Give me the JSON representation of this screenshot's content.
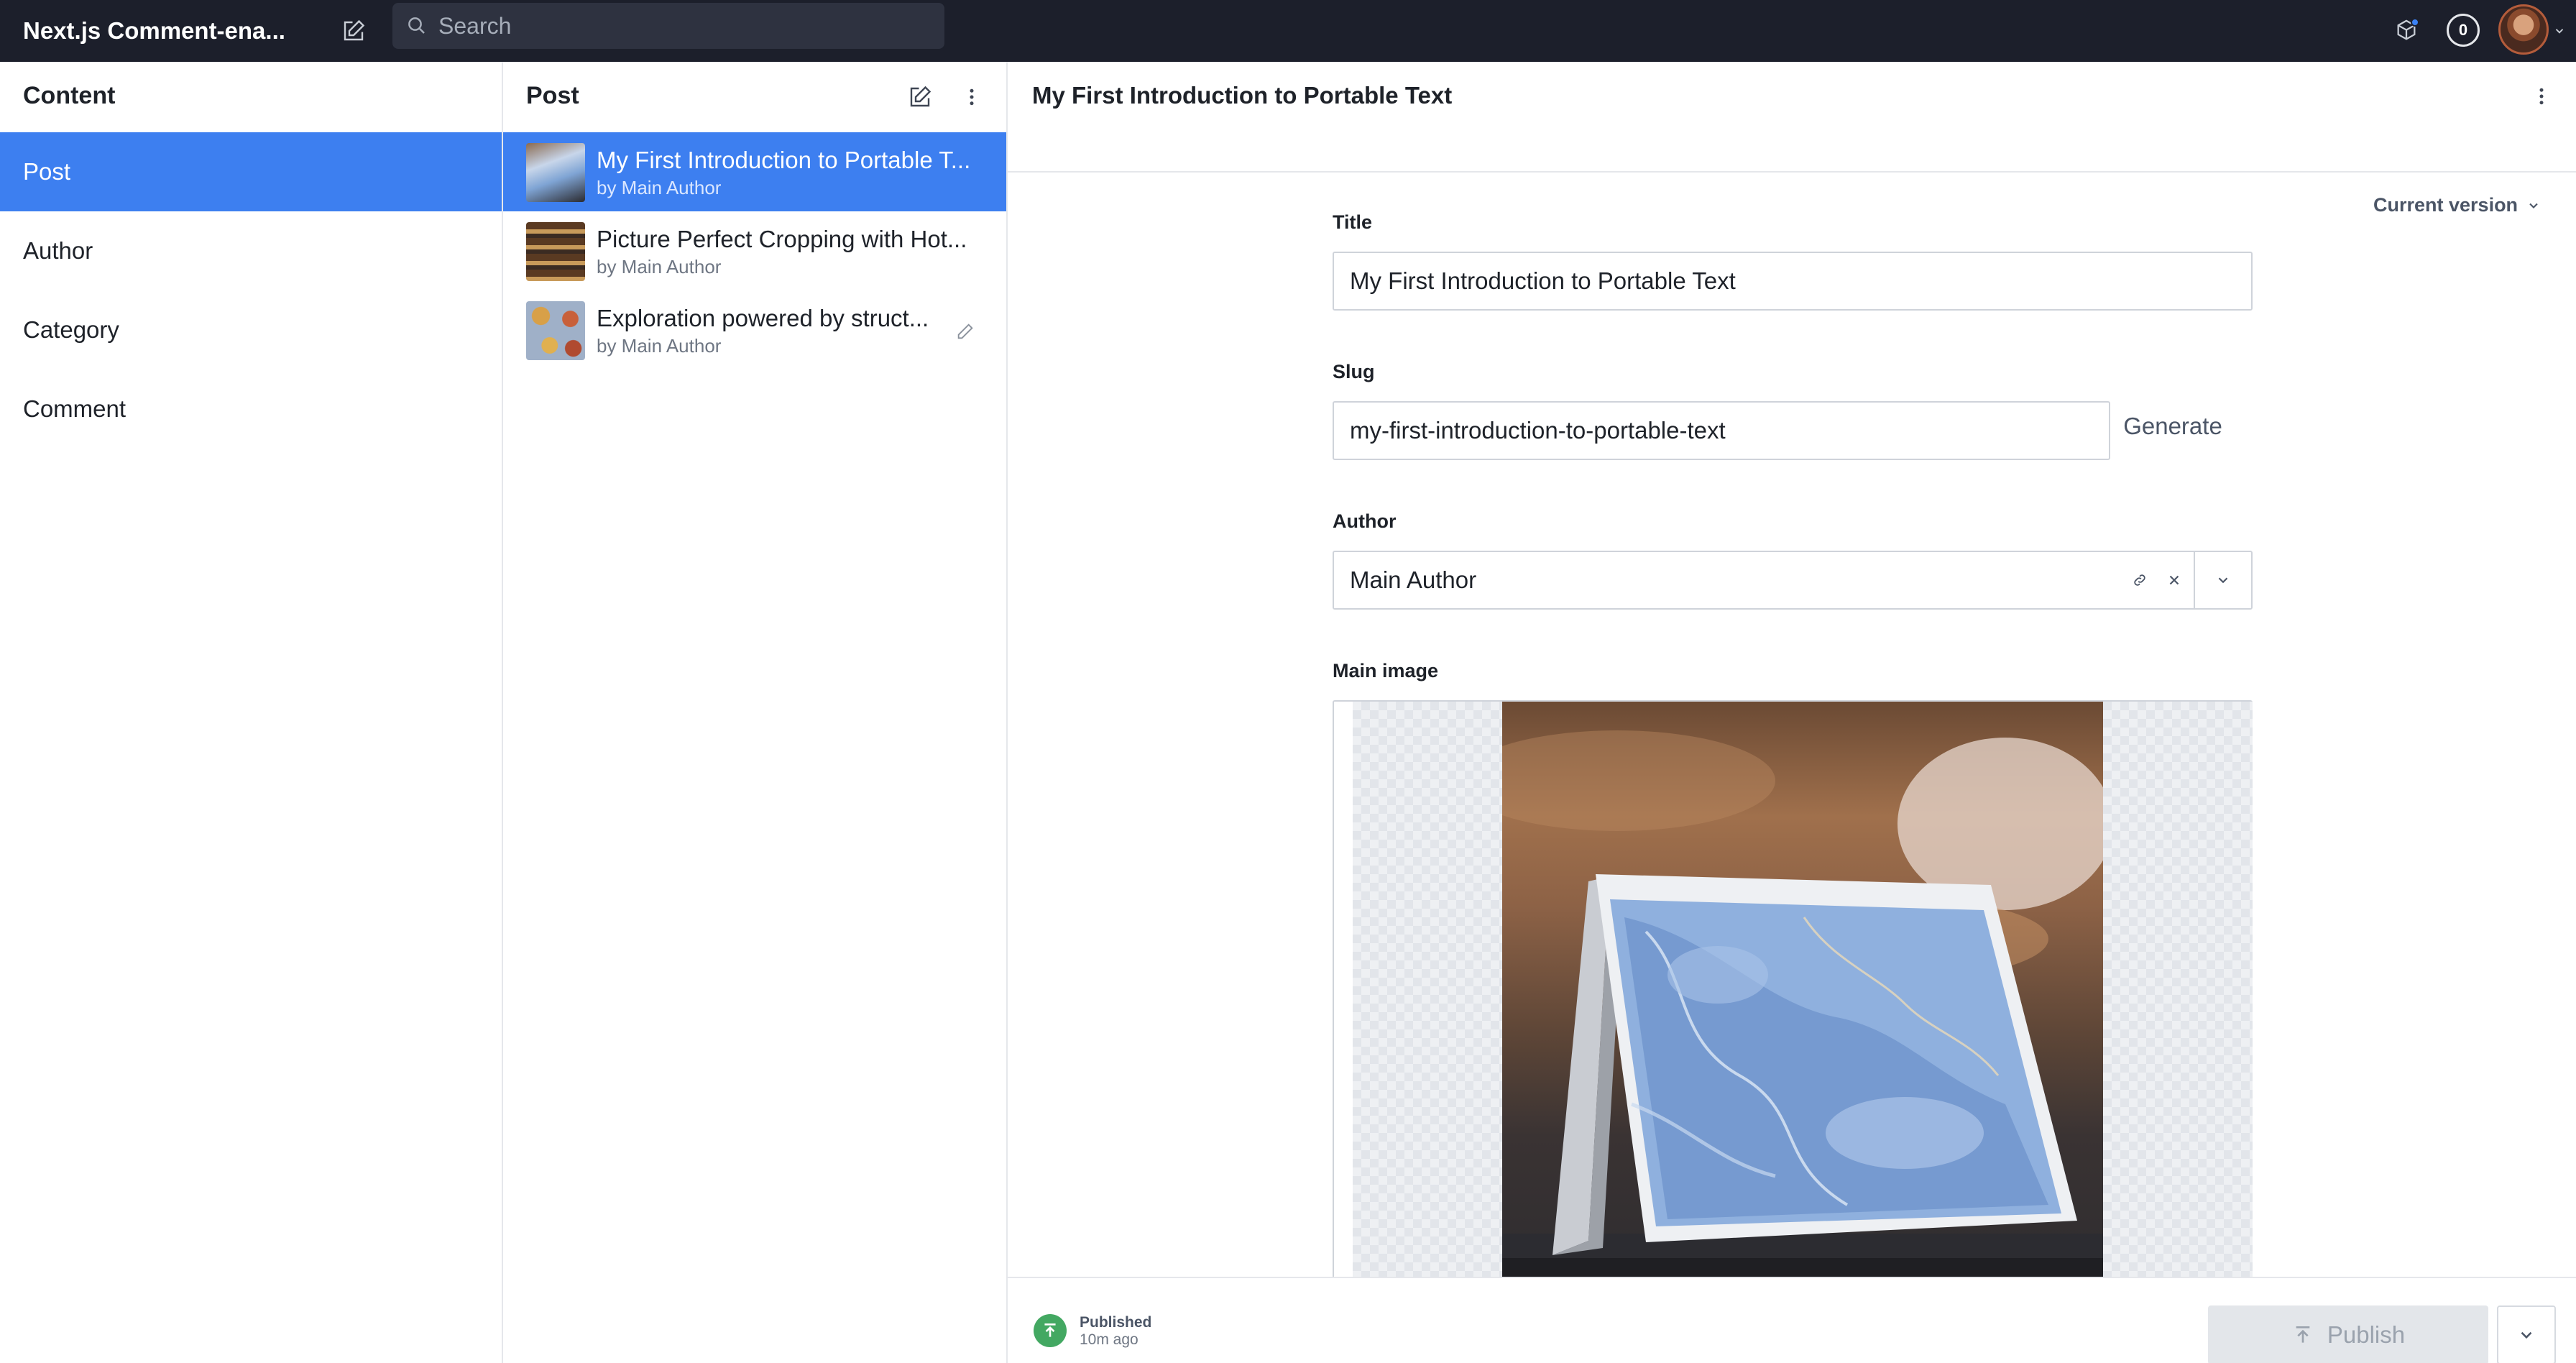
{
  "topbar": {
    "app_title": "Next.js Comment-ena...",
    "search_placeholder": "Search",
    "notification_count": "0",
    "icons": {
      "compose": "compose-icon",
      "search": "search-icon",
      "cube": "cube-icon",
      "avatar": "avatar",
      "caret": "chevron-down-icon"
    },
    "accent_dot_color": "#3b82f6"
  },
  "content_pane": {
    "title": "Content",
    "items": [
      {
        "label": "Post",
        "active": true
      },
      {
        "label": "Author",
        "active": false
      },
      {
        "label": "Category",
        "active": false
      },
      {
        "label": "Comment",
        "active": false
      }
    ]
  },
  "list_pane": {
    "title": "Post",
    "posts": [
      {
        "title": "My First Introduction to Portable T...",
        "subtitle": "by Main Author",
        "active": true
      },
      {
        "title": "Picture Perfect Cropping with Hot...",
        "subtitle": "by Main Author",
        "active": false
      },
      {
        "title": "Exploration powered by struct...",
        "subtitle": "by Main Author",
        "active": false
      }
    ]
  },
  "document": {
    "title": "My First Introduction to Portable Text",
    "version_label": "Current version",
    "fields": {
      "title_label": "Title",
      "title_value": "My First Introduction to Portable Text",
      "slug_label": "Slug",
      "slug_value": "my-first-introduction-to-portable-text",
      "generate_label": "Generate",
      "author_label": "Author",
      "author_value": "Main Author",
      "image_label": "Main image"
    },
    "footer": {
      "status_label": "Published",
      "status_time": "10m ago",
      "publish_label": "Publish"
    }
  },
  "colors": {
    "accent": "#3d7ff0",
    "topbar": "#1c1f2b",
    "status_green": "#43a862"
  }
}
